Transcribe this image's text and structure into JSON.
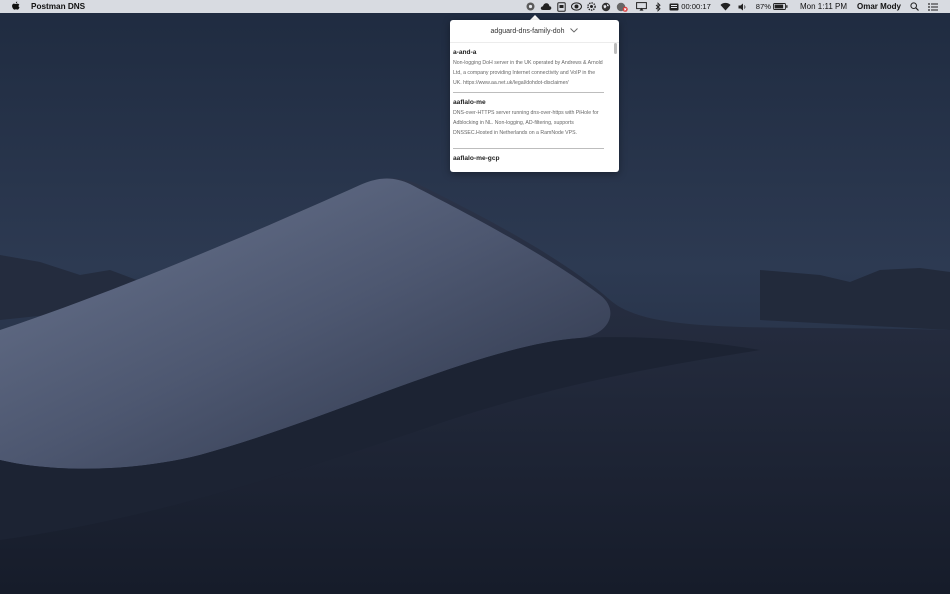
{
  "menubar": {
    "app_name": "Postman DNS",
    "timer": "00:00:17",
    "battery": "87%",
    "clock": "Mon 1:11 PM",
    "user": "Omar Mody",
    "tray_icons": [
      "postman-dns-icon",
      "creative-cloud-icon",
      "document-icon",
      "eye-icon",
      "gear-app-icon",
      "globe-app-icon",
      "vpn-globe-icon",
      "bluetooth-icon",
      "timer-icon",
      "wifi-icon",
      "volume-icon",
      "battery-icon",
      "spotlight-icon",
      "notification-center-icon"
    ]
  },
  "popover": {
    "selected_server": "adguard-dns-family-doh",
    "servers": [
      {
        "name": "a-and-a",
        "description": "Non-logging DoH server in the UK operated by Andrews & Arnold Ltd, a company providing Internet connectivity and VoIP in the UK.  https://www.aa.net.uk/legal/dohdot-disclaimer/"
      },
      {
        "name": "aaflalo-me",
        "description": "DNS-over-HTTPS server running dns-over-https with PiHole for Adblocking in NL.  Non-logging, AD-filtering, supports DNSSEC.Hosted in Netherlands on a RamNode VPS."
      },
      {
        "name": "aaflalo-me-gcp",
        "description": ""
      }
    ]
  },
  "colors": {
    "menubar_bg": "#e6e8ee",
    "sky": "#1d2638",
    "dune": "#4a5568"
  }
}
